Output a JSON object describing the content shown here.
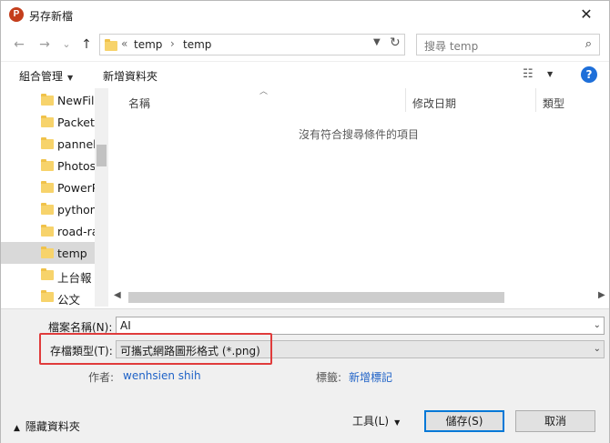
{
  "window": {
    "title": "另存新檔",
    "app_icon_letter": "P",
    "close_glyph": "✕"
  },
  "nav": {
    "back_glyph": "←",
    "forward_glyph": "→",
    "recent_glyph": "⌄",
    "up_glyph": "↑",
    "address": {
      "prefix": "«",
      "crumb1": "temp",
      "separator": "›",
      "crumb2": "temp"
    },
    "refresh_glyph": "↻",
    "search_placeholder": "搜尋 temp",
    "search_glyph": "⌕"
  },
  "toolbar": {
    "organize_label": "組合管理",
    "new_folder_label": "新增資料夾",
    "view_glyph": "☷",
    "help_glyph": "?"
  },
  "navpane": {
    "items": [
      {
        "label": "NewFil"
      },
      {
        "label": "Packet"
      },
      {
        "label": "pannel"
      },
      {
        "label": "Photos"
      },
      {
        "label": "PowerP"
      },
      {
        "label": "python"
      },
      {
        "label": "road-ra"
      },
      {
        "label": "temp"
      },
      {
        "label": "上台報"
      },
      {
        "label": "公文"
      }
    ],
    "selected_index": 7
  },
  "filelist": {
    "columns": {
      "name": "名稱",
      "modified": "修改日期",
      "type": "類型"
    },
    "empty_message": "沒有符合搜尋條件的項目"
  },
  "form": {
    "filename_label": "檔案名稱(N):",
    "filename_value": "AI",
    "filetype_label": "存檔類型(T):",
    "filetype_value": "可攜式網路圖形格式 (*.png)",
    "author_label": "作者:",
    "author_value": "wenhsien shih",
    "tags_label": "標籤:",
    "tags_value": "新增標記"
  },
  "footer": {
    "hide_folders_label": "隱藏資料夾",
    "tools_label": "工具(L)",
    "save_label": "儲存(S)",
    "cancel_label": "取消"
  },
  "colors": {
    "accent": "#0078d7",
    "highlight": "#e03b3b",
    "link": "#2063c7",
    "folder": "#f7d36b"
  }
}
